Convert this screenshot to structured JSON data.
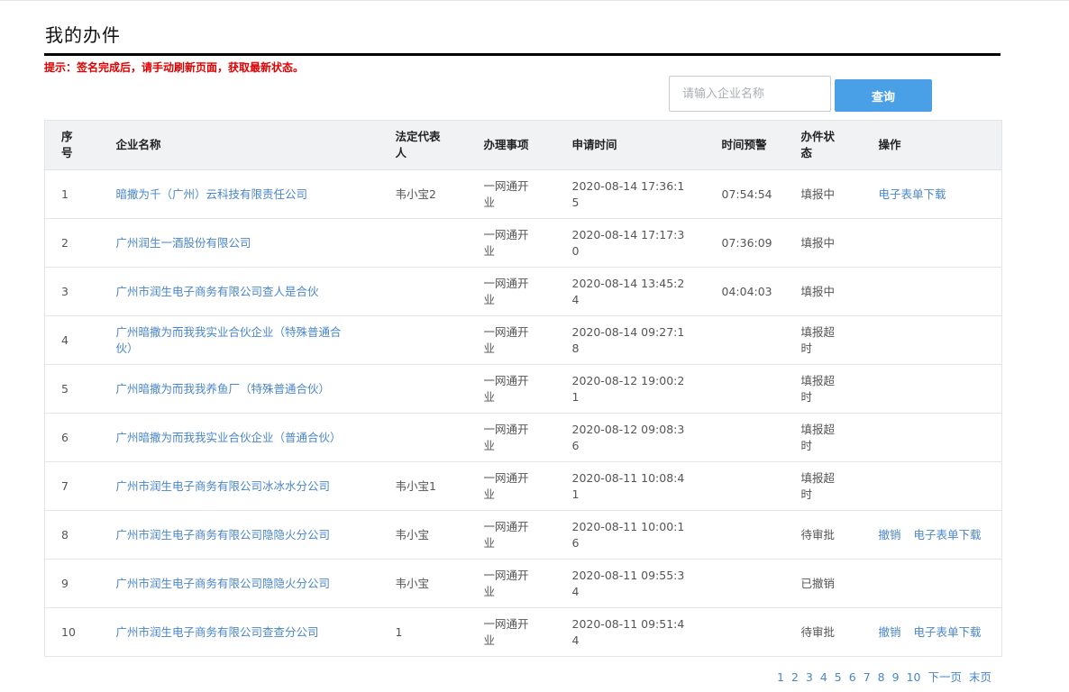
{
  "page": {
    "title": "我的办件",
    "notice": "提示：签名完成后，请手动刷新页面，获取最新状态。"
  },
  "search": {
    "placeholder": "请输入企业名称",
    "value": "",
    "button_label": "查询"
  },
  "table": {
    "headers": {
      "index": "序号",
      "company": "企业名称",
      "legal_rep": "法定代表人",
      "item": "办理事项",
      "apply_time": "申请时间",
      "time_warning": "时间预警",
      "status": "办件状态",
      "actions": "操作"
    },
    "rows": [
      {
        "index": "1",
        "company": "暗撒为千（广州）云科技有限责任公司",
        "legal_rep": "韦小宝2",
        "item": "一网通开业",
        "apply_time": "2020-08-14 17:36:15",
        "time_warning": "07:54:54",
        "status": "填报中",
        "action1": "",
        "action2": "电子表单下载"
      },
      {
        "index": "2",
        "company": "广州润生一酒股份有限公司",
        "legal_rep": "",
        "item": "一网通开业",
        "apply_time": "2020-08-14 17:17:30",
        "time_warning": "07:36:09",
        "status": "填报中",
        "action1": "",
        "action2": ""
      },
      {
        "index": "3",
        "company": "广州市润生电子商务有限公司查人是合伙",
        "legal_rep": "",
        "item": "一网通开业",
        "apply_time": "2020-08-14 13:45:24",
        "time_warning": "04:04:03",
        "status": "填报中",
        "action1": "",
        "action2": ""
      },
      {
        "index": "4",
        "company": "广州暗撒为而我我实业合伙企业（特殊普通合伙）",
        "legal_rep": "",
        "item": "一网通开业",
        "apply_time": "2020-08-14 09:27:18",
        "time_warning": "",
        "status": "填报超时",
        "action1": "",
        "action2": ""
      },
      {
        "index": "5",
        "company": "广州暗撒为而我我养鱼厂（特殊普通合伙）",
        "legal_rep": "",
        "item": "一网通开业",
        "apply_time": "2020-08-12 19:00:21",
        "time_warning": "",
        "status": "填报超时",
        "action1": "",
        "action2": ""
      },
      {
        "index": "6",
        "company": "广州暗撒为而我我实业合伙企业（普通合伙）",
        "legal_rep": "",
        "item": "一网通开业",
        "apply_time": "2020-08-12 09:08:36",
        "time_warning": "",
        "status": "填报超时",
        "action1": "",
        "action2": ""
      },
      {
        "index": "7",
        "company": "广州市润生电子商务有限公司冰冰水分公司",
        "legal_rep": "韦小宝1",
        "item": "一网通开业",
        "apply_time": "2020-08-11 10:08:41",
        "time_warning": "",
        "status": "填报超时",
        "action1": "",
        "action2": ""
      },
      {
        "index": "8",
        "company": "广州市润生电子商务有限公司隐隐火分公司",
        "legal_rep": "韦小宝",
        "item": "一网通开业",
        "apply_time": "2020-08-11 10:00:16",
        "time_warning": "",
        "status": "待审批",
        "action1": "撤销",
        "action2": "电子表单下载"
      },
      {
        "index": "9",
        "company": "广州市润生电子商务有限公司隐隐火分公司",
        "legal_rep": "韦小宝",
        "item": "一网通开业",
        "apply_time": "2020-08-11 09:55:34",
        "time_warning": "",
        "status": "已撤销",
        "action1": "",
        "action2": ""
      },
      {
        "index": "10",
        "company": "广州市润生电子商务有限公司查查分公司",
        "legal_rep": "1",
        "item": "一网通开业",
        "apply_time": "2020-08-11 09:51:44",
        "time_warning": "",
        "status": "待审批",
        "action1": "撤销",
        "action2": "电子表单下载"
      }
    ]
  },
  "pagination": {
    "pages": [
      "1",
      "2",
      "3",
      "4",
      "5",
      "6",
      "7",
      "8",
      "9",
      "10"
    ],
    "next_label": "下一页",
    "last_label": "末页"
  },
  "colors": {
    "accent": "#4aa0e6",
    "link": "#4a86c8",
    "notice": "#e00000",
    "header_bg": "#f1f2f4"
  }
}
